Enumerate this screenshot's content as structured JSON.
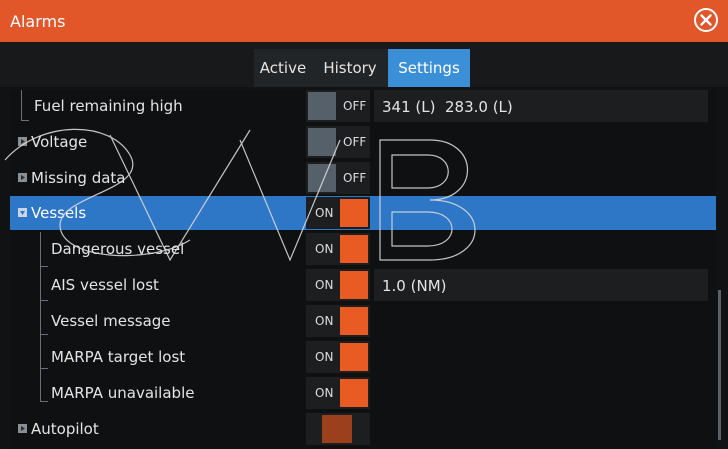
{
  "window": {
    "title": "Alarms"
  },
  "tabs": [
    {
      "label": "Active",
      "active": false
    },
    {
      "label": "History",
      "active": false
    },
    {
      "label": "Settings",
      "active": true
    }
  ],
  "rows": [
    {
      "label": "Fuel remaining high",
      "state": "OFF",
      "value": "341 (L)  283.0 (L)"
    },
    {
      "label": "Voltage",
      "state": "OFF"
    },
    {
      "label": "Missing data",
      "state": "OFF"
    },
    {
      "label": "Vessels",
      "state": "ON",
      "selected": true
    },
    {
      "label": "Dangerous vessel",
      "state": "ON"
    },
    {
      "label": "AIS vessel lost",
      "state": "ON",
      "value": "1.0 (NM)"
    },
    {
      "label": "Vessel message",
      "state": "ON"
    },
    {
      "label": "MARPA target lost",
      "state": "ON"
    },
    {
      "label": "MARPA unavailable",
      "state": "ON"
    },
    {
      "label": "Autopilot"
    }
  ],
  "colors": {
    "accent": "#e2572a",
    "selection": "#2e77c7",
    "tab_active": "#3a8fd6",
    "toggle_on": "#e85b22"
  },
  "icons": {
    "close": "close-circle-icon",
    "expander": "triangle-expander-icon"
  }
}
